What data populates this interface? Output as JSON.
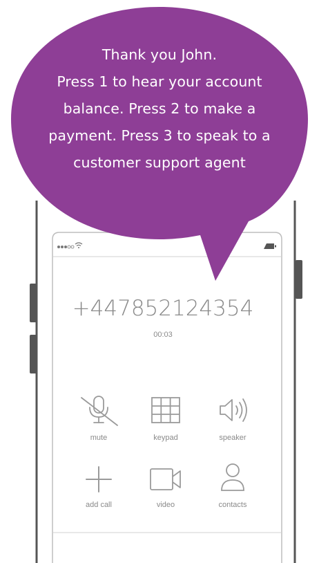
{
  "bubble": {
    "color": "#8e3e96",
    "lines": [
      "Thank you John.",
      "Press 1 to hear your account",
      "balance. Press 2 to make a",
      "payment. Press 3 to speak to a",
      "customer support agent"
    ]
  },
  "call": {
    "number": "+447852124354",
    "timer": "00:03"
  },
  "buttons": {
    "mute": "mute",
    "keypad": "keypad",
    "speaker": "speaker",
    "add_call": "add call",
    "video": "video",
    "contacts": "contacts"
  },
  "icons": [
    "signal-dots-icon",
    "wifi-icon",
    "battery-icon",
    "mute-icon",
    "keypad-icon",
    "speaker-icon",
    "add-call-icon",
    "video-icon",
    "contacts-icon"
  ]
}
